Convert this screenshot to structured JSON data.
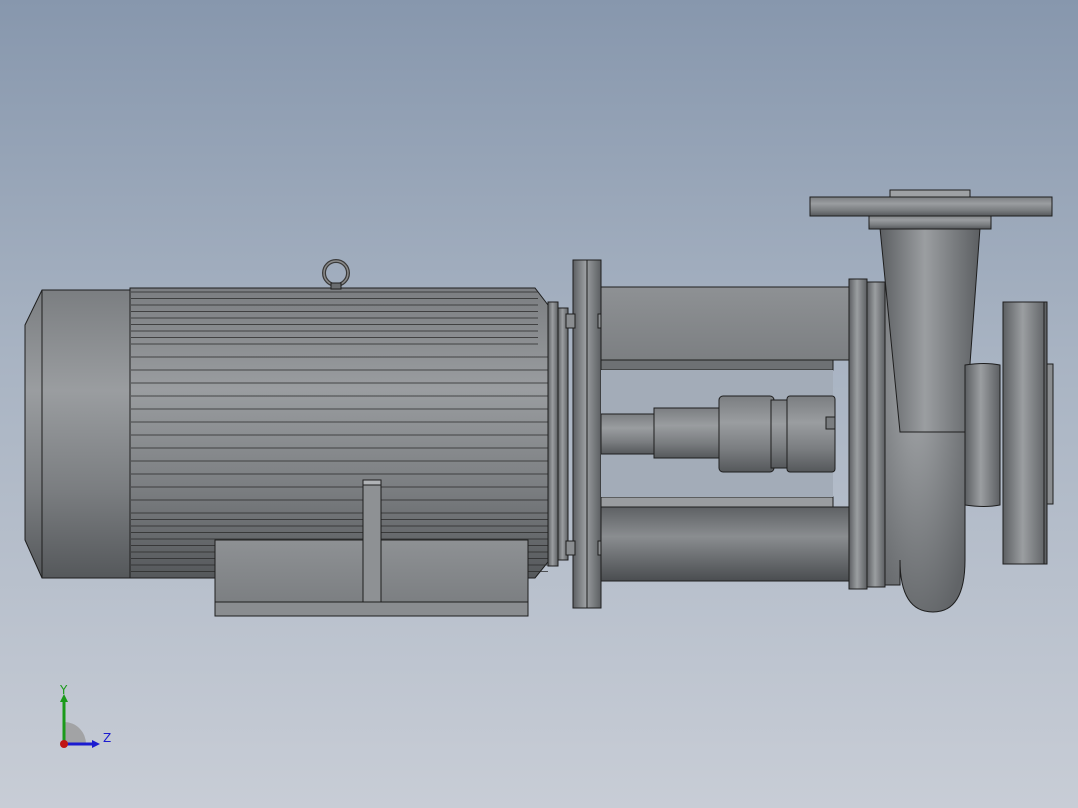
{
  "viewport": {
    "background_top": "#8797ad",
    "background_bottom": "#c8cdd6",
    "part_fill": "#808386",
    "edge_color": "#1e1e1e"
  },
  "triad": {
    "y_label": "Y",
    "z_label": "Z",
    "y_color": "#1a9a1a",
    "z_color": "#1b1bd0",
    "x_color": "#c01515"
  }
}
